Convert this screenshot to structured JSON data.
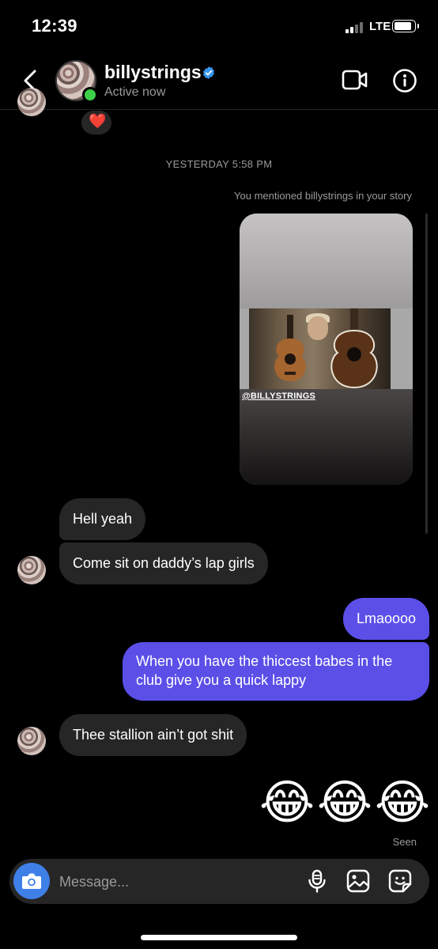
{
  "status_bar": {
    "time": "12:39",
    "network": "LTE"
  },
  "header": {
    "username": "billystrings",
    "status": "Active now"
  },
  "reaction": {
    "emoji": "❤️"
  },
  "timestamp": "YESTERDAY 5:58 PM",
  "mention_note": "You mentioned billystrings in your story",
  "story": {
    "tag": "@BILLYSTRINGS"
  },
  "messages": [
    {
      "from": "them",
      "text": "Hell yeah"
    },
    {
      "from": "them",
      "text": "Come sit on daddy’s lap girls"
    },
    {
      "from": "me",
      "text": "Lmaoooo"
    },
    {
      "from": "me",
      "text": "When you have the thiccest babes in the club give you a quick lappy"
    },
    {
      "from": "them",
      "text": "Thee stallion ain’t got shit"
    }
  ],
  "emoji_message": [
    "😂",
    "😂",
    "😂"
  ],
  "seen_label": "Seen",
  "composer": {
    "placeholder": "Message..."
  },
  "colors": {
    "outgoing_bubble": "#5b4fe8",
    "incoming_bubble": "#262626",
    "camera_button": "#3f7fe8",
    "online": "#3dd14a",
    "verified": "#3897f0"
  }
}
